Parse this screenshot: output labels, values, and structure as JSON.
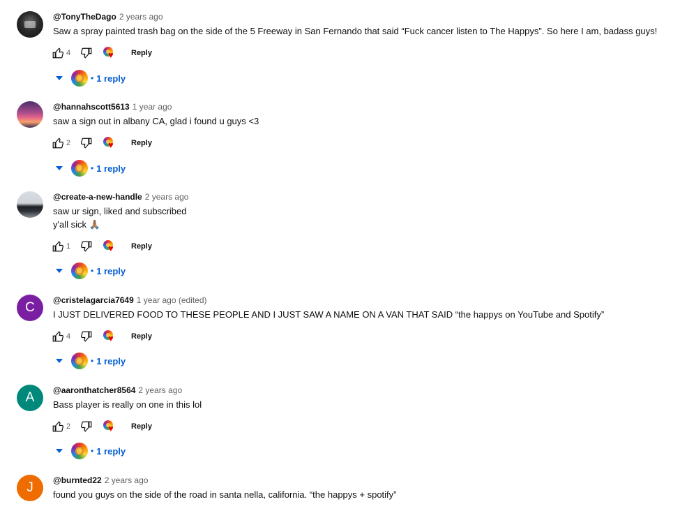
{
  "labels": {
    "reply": "Reply"
  },
  "colors": {
    "link_blue": "#065fd4",
    "heart_red": "#e00000",
    "meta_gray": "#606060"
  },
  "comments": [
    {
      "author": "@TonyTheDago",
      "time": "2 years ago",
      "text": "Saw a spray painted trash bag on the side of the 5 Freeway in San Fernando that said “Fuck cancer listen to The Happys”. So here I am, badass guys!",
      "likes": "4",
      "avatar": "photo-dark",
      "replies": "1 reply"
    },
    {
      "author": "@hannahscott5613",
      "time": "1 year ago",
      "text": "saw a sign out in albany CA, glad i found u guys <3",
      "likes": "2",
      "avatar": "photo-sunset",
      "replies": "1 reply"
    },
    {
      "author": "@create-a-new-handle",
      "time": "2 years ago",
      "text": "saw ur sign, liked and subscribed\ny'all sick 🙏🏽",
      "likes": "1",
      "avatar": "photo-car",
      "replies": "1 reply"
    },
    {
      "author": "@cristelagarcia7649",
      "time": "1 year ago (edited)",
      "text": "I JUST DELIVERED FOOD TO THESE PEOPLE AND I JUST SAW A NAME ON A VAN THAT SAID “the happys on YouTube and Spotify”",
      "likes": "4",
      "avatar_letter": "C",
      "replies": "1 reply"
    },
    {
      "author": "@aaronthatcher8564",
      "time": "2 years ago",
      "text": "Bass player is really on one in this lol",
      "likes": "2",
      "avatar_letter": "A",
      "replies": "1 reply"
    },
    {
      "author": "@burnted22",
      "time": "2 years ago",
      "text": "found you guys on the side of the road in santa nella, california. “the happys + spotify”",
      "avatar_letter": "J"
    }
  ]
}
